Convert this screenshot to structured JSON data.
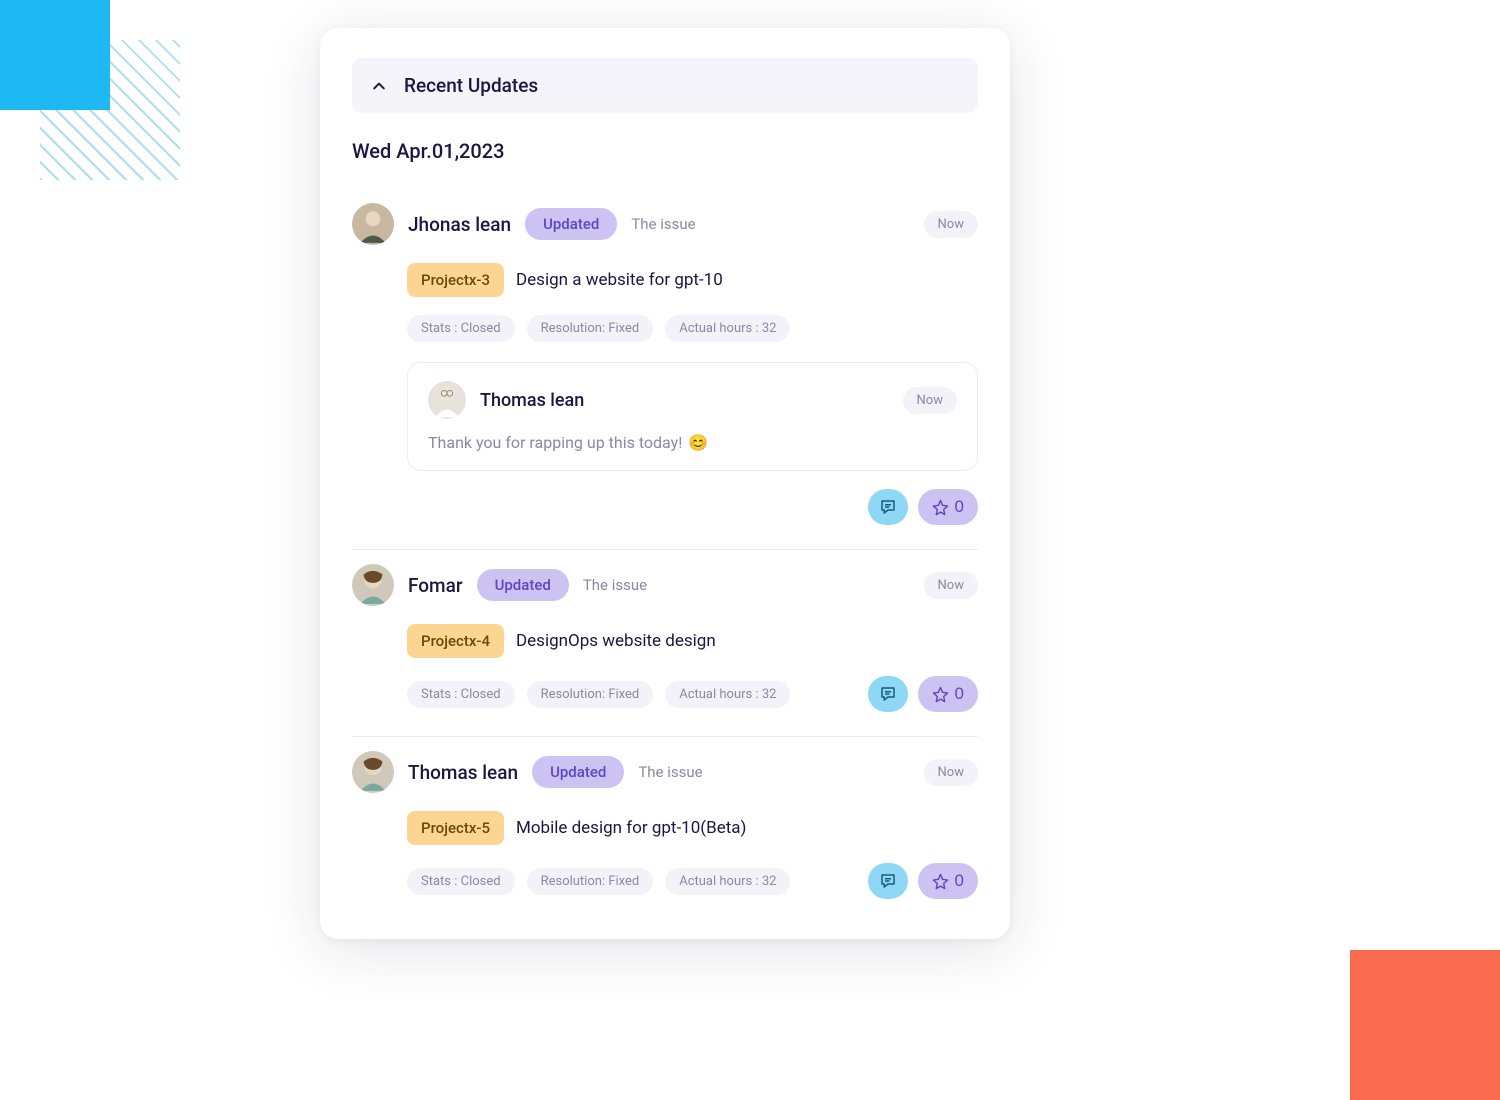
{
  "header": {
    "title": "Recent Updates"
  },
  "date": "Wed Apr.01,2023",
  "updates": [
    {
      "user": "Jhonas lean",
      "action": "Updated",
      "suffix": "The issue",
      "time": "Now",
      "project": "Projectx-3",
      "task": "Design a website for gpt-10",
      "stats": "Stats : Closed",
      "resolution": "Resolution: Fixed",
      "hours": "Actual hours : 32",
      "comment": {
        "user": "Thomas lean",
        "time": "Now",
        "body": "Thank you for rapping up this today!",
        "emoji": "😊"
      },
      "star_count": "0"
    },
    {
      "user": "Fomar",
      "action": "Updated",
      "suffix": "The issue",
      "time": "Now",
      "project": "Projectx-4",
      "task": "DesignOps website design",
      "stats": "Stats : Closed",
      "resolution": "Resolution: Fixed",
      "hours": "Actual hours : 32",
      "star_count": "0"
    },
    {
      "user": "Thomas lean",
      "action": "Updated",
      "suffix": "The issue",
      "time": "Now",
      "project": "Projectx-5",
      "task": "Mobile design for gpt-10(Beta)",
      "stats": "Stats : Closed",
      "resolution": "Resolution: Fixed",
      "hours": "Actual hours : 32",
      "star_count": "0"
    }
  ]
}
